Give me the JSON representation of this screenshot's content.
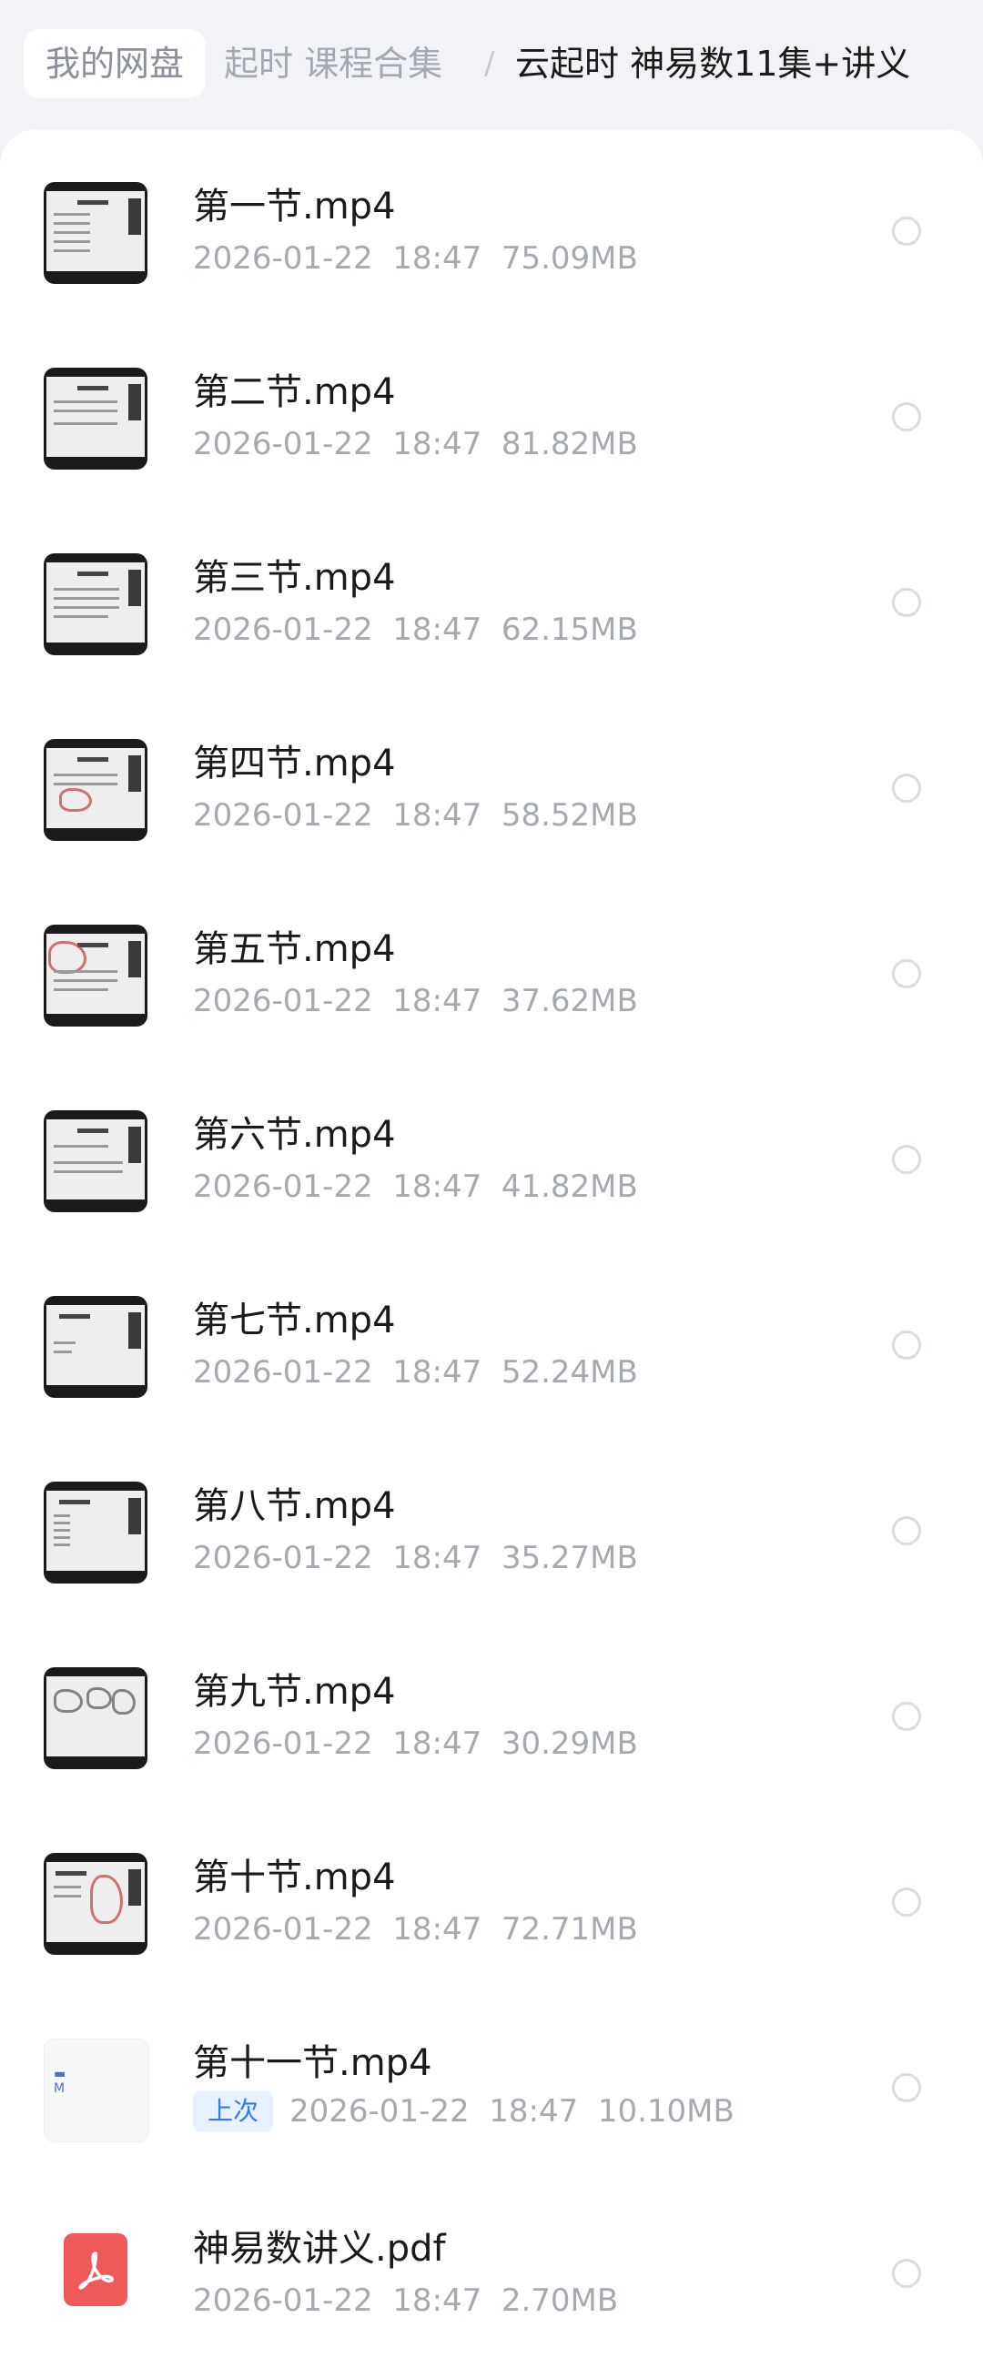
{
  "breadcrumb": {
    "root": "我的网盘",
    "middle": "起时 课程合集",
    "separator": "/",
    "current": "云起时 神易数11集+讲义"
  },
  "files": [
    {
      "name": "第一节.mp4",
      "date": "2026-01-22",
      "time": "18:47",
      "size": "75.09MB",
      "icon": "video-thumbnail-icon"
    },
    {
      "name": "第二节.mp4",
      "date": "2026-01-22",
      "time": "18:47",
      "size": "81.82MB",
      "icon": "video-thumbnail-icon"
    },
    {
      "name": "第三节.mp4",
      "date": "2026-01-22",
      "time": "18:47",
      "size": "62.15MB",
      "icon": "video-thumbnail-icon"
    },
    {
      "name": "第四节.mp4",
      "date": "2026-01-22",
      "time": "18:47",
      "size": "58.52MB",
      "icon": "video-thumbnail-icon"
    },
    {
      "name": "第五节.mp4",
      "date": "2026-01-22",
      "time": "18:47",
      "size": "37.62MB",
      "icon": "video-thumbnail-icon"
    },
    {
      "name": "第六节.mp4",
      "date": "2026-01-22",
      "time": "18:47",
      "size": "41.82MB",
      "icon": "video-thumbnail-icon"
    },
    {
      "name": "第七节.mp4",
      "date": "2026-01-22",
      "time": "18:47",
      "size": "52.24MB",
      "icon": "video-thumbnail-icon"
    },
    {
      "name": "第八节.mp4",
      "date": "2026-01-22",
      "time": "18:47",
      "size": "35.27MB",
      "icon": "video-thumbnail-icon"
    },
    {
      "name": "第九节.mp4",
      "date": "2026-01-22",
      "time": "18:47",
      "size": "30.29MB",
      "icon": "video-thumbnail-icon"
    },
    {
      "name": "第十节.mp4",
      "date": "2026-01-22",
      "time": "18:47",
      "size": "72.71MB",
      "icon": "video-thumbnail-icon"
    },
    {
      "name": "第十一节.mp4",
      "badge": "上次",
      "date": "2026-01-22",
      "time": "18:47",
      "size": "10.10MB",
      "icon": "video-thumbnail-icon"
    },
    {
      "name": "神易数讲义.pdf",
      "date": "2026-01-22",
      "time": "18:47",
      "size": "2.70MB",
      "icon": "pdf-icon"
    }
  ],
  "colors": {
    "background": "#f2f3f6",
    "badge_text": "#2f7bf5",
    "badge_bg": "#e8f1ff",
    "pdf_icon": "#f0595a"
  }
}
